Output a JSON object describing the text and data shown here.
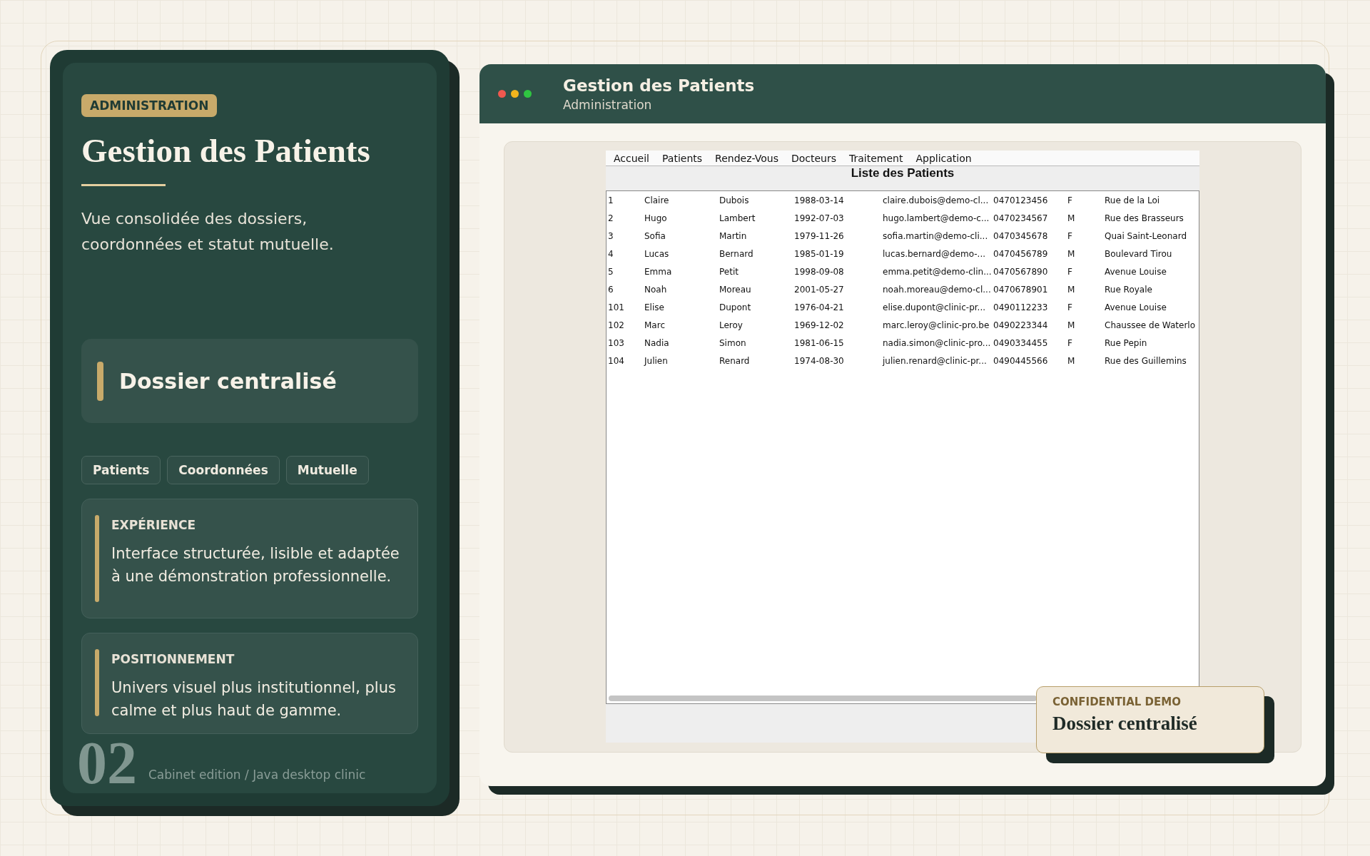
{
  "sidebar": {
    "badge": "ADMINISTRATION",
    "title": "Gestion des Patients",
    "description": "Vue consolidée des dossiers, coordonnées et statut mutuelle.",
    "highlight": "Dossier centralisé",
    "tags": [
      "Patients",
      "Coordonnées",
      "Mutuelle"
    ],
    "cards": [
      {
        "heading": "EXPÉRIENCE",
        "text": "Interface structurée, lisible et adaptée à une démonstration professionnelle."
      },
      {
        "heading": "POSITIONNEMENT",
        "text": "Univers visuel plus institutionnel, plus calme et plus haut de gamme."
      }
    ],
    "footer": {
      "number": "02",
      "caption": "Cabinet edition / Java desktop clinic"
    }
  },
  "window": {
    "title": "Gestion des Patients",
    "subtitle": "Administration"
  },
  "app": {
    "menu": [
      "Accueil",
      "Patients",
      "Rendez-Vous",
      "Docteurs",
      "Traitement",
      "Application"
    ],
    "heading": "Liste des Patients",
    "rows": [
      [
        "1",
        "Claire",
        "Dubois",
        "1988-03-14",
        "claire.dubois@demo-cl...",
        "0470123456",
        "F",
        "Rue de la Loi"
      ],
      [
        "2",
        "Hugo",
        "Lambert",
        "1992-07-03",
        "hugo.lambert@demo-c...",
        "0470234567",
        "M",
        "Rue des Brasseurs"
      ],
      [
        "3",
        "Sofia",
        "Martin",
        "1979-11-26",
        "sofia.martin@demo-cli...",
        "0470345678",
        "F",
        "Quai Saint-Leonard"
      ],
      [
        "4",
        "Lucas",
        "Bernard",
        "1985-01-19",
        "lucas.bernard@demo-...",
        "0470456789",
        "M",
        "Boulevard Tirou"
      ],
      [
        "5",
        "Emma",
        "Petit",
        "1998-09-08",
        "emma.petit@demo-clin...",
        "0470567890",
        "F",
        "Avenue Louise"
      ],
      [
        "6",
        "Noah",
        "Moreau",
        "2001-05-27",
        "noah.moreau@demo-cl...",
        "0470678901",
        "M",
        "Rue Royale"
      ],
      [
        "101",
        "Elise",
        "Dupont",
        "1976-04-21",
        "elise.dupont@clinic-pr...",
        "0490112233",
        "F",
        "Avenue Louise"
      ],
      [
        "102",
        "Marc",
        "Leroy",
        "1969-12-02",
        "marc.leroy@clinic-pro.be",
        "0490223344",
        "M",
        "Chaussee de Waterlo"
      ],
      [
        "103",
        "Nadia",
        "Simon",
        "1981-06-15",
        "nadia.simon@clinic-pro...",
        "0490334455",
        "F",
        "Rue Pepin"
      ],
      [
        "104",
        "Julien",
        "Renard",
        "1974-08-30",
        "julien.renard@clinic-pr...",
        "0490445566",
        "M",
        "Rue des Guillemins"
      ]
    ]
  },
  "note": {
    "label": "CONFIDENTIAL DEMO",
    "title": "Dossier centralisé"
  }
}
